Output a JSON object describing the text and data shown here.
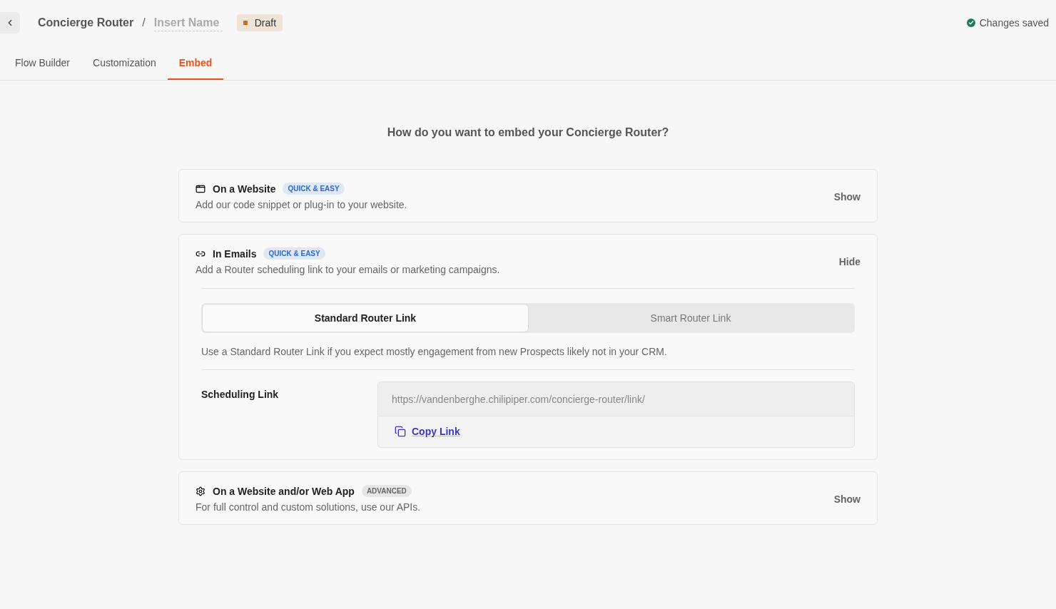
{
  "header": {
    "breadcrumb": "Concierge Router",
    "separator": "/",
    "name_placeholder": "Insert Name",
    "status": "Draft",
    "save_status": "Changes saved"
  },
  "tabs": [
    {
      "label": "Flow Builder",
      "selected": false
    },
    {
      "label": "Customization",
      "selected": false
    },
    {
      "label": "Embed",
      "selected": true
    }
  ],
  "heading": "How do you want to embed your Concierge Router?",
  "sections": [
    {
      "kind": "website",
      "title": "On a Website",
      "badge": {
        "text": "QUICK & EASY",
        "color": "#2a6bc4"
      },
      "description": "Add our code snippet or plug-in to your website.",
      "toggle": "Show"
    },
    {
      "kind": "link",
      "title": "In Emails",
      "badge": {
        "text": "QUICK & EASY",
        "color": "#2a6bc4"
      },
      "description": "Add a Router scheduling link to your emails or marketing campaigns.",
      "toggle": "Hide",
      "details": {
        "link_types": [
          {
            "label": "Standard Router Link",
            "selected": true
          },
          {
            "label": "Smart Router Link",
            "selected": false
          }
        ],
        "hint": "Use a Standard Router Link if you expect mostly engagement from new Prospects likely not in your CRM.",
        "field_label": "Scheduling Link",
        "url": "https://vandenberghe.chilipiper.com/concierge-router/link/",
        "copy": "Copy Link"
      }
    },
    {
      "kind": "gear",
      "title": "On a Website and/or Web App",
      "badge": {
        "text": "ADVANCED",
        "color": "#666666"
      },
      "description": "For full control and custom solutions, use our APIs.",
      "toggle": "Show"
    }
  ]
}
